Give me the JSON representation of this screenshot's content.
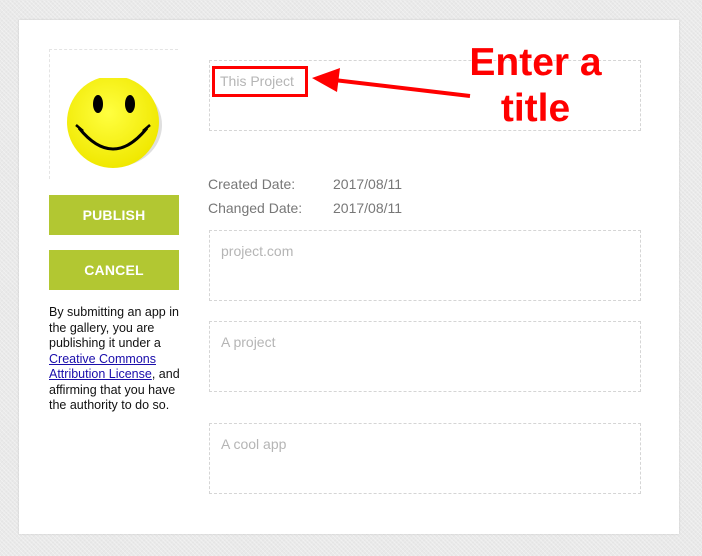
{
  "actions": {
    "publish_label": "PUBLISH",
    "cancel_label": "CANCEL"
  },
  "notice": {
    "before": "By submitting an app in the gallery, you are publishing it under a ",
    "link_text": "Creative Commons Attribution License",
    "after": ", and affirming that you have the authority to do so."
  },
  "form": {
    "title_placeholder": "This Project",
    "created_label": "Created Date:",
    "created_value": "2017/08/11",
    "changed_label": "Changed Date:",
    "changed_value": "2017/08/11",
    "url_placeholder": "project.com",
    "description_placeholder": "A project",
    "tagline_placeholder": "A cool app"
  },
  "annotation": {
    "text": "Enter a title",
    "color": "#ff0000"
  },
  "colors": {
    "button": "#b2c732",
    "smiley": "#ffff00"
  }
}
